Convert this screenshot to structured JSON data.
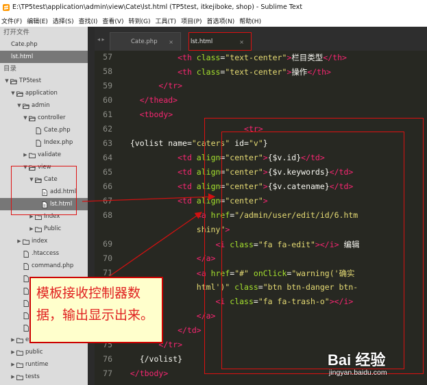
{
  "window": {
    "title": "E:\\TP5test\\application\\admin\\view\\Cate\\lst.html (TP5test, itkejiboke, shop) - Sublime Text"
  },
  "menu": [
    "文件(F)",
    "编辑(E)",
    "选择(S)",
    "查找(I)",
    "查看(V)",
    "转到(G)",
    "工具(T)",
    "项目(P)",
    "首选项(N)",
    "帮助(H)"
  ],
  "sidebar": {
    "open_files_header": "打开文件",
    "open_files": [
      "Cate.php",
      "lst.html"
    ],
    "folders_header": "目录",
    "tree": [
      {
        "label": "TP5test",
        "depth": 0,
        "type": "folder",
        "open": true
      },
      {
        "label": "application",
        "depth": 1,
        "type": "folder",
        "open": true
      },
      {
        "label": "admin",
        "depth": 2,
        "type": "folder",
        "open": true
      },
      {
        "label": "controller",
        "depth": 3,
        "type": "folder",
        "open": true
      },
      {
        "label": "Cate.php",
        "depth": 4,
        "type": "file"
      },
      {
        "label": "Index.php",
        "depth": 4,
        "type": "file"
      },
      {
        "label": "validate",
        "depth": 3,
        "type": "folder",
        "open": false
      },
      {
        "label": "view",
        "depth": 3,
        "type": "folder",
        "open": true
      },
      {
        "label": "Cate",
        "depth": 4,
        "type": "folder",
        "open": true
      },
      {
        "label": "add.html",
        "depth": 5,
        "type": "code"
      },
      {
        "label": "lst.html",
        "depth": 5,
        "type": "code",
        "selected": true
      },
      {
        "label": "Index",
        "depth": 4,
        "type": "folder",
        "open": false
      },
      {
        "label": "Public",
        "depth": 4,
        "type": "folder",
        "open": false
      },
      {
        "label": "index",
        "depth": 2,
        "type": "folder",
        "open": false
      },
      {
        "label": ".htaccess",
        "depth": 2,
        "type": "file"
      },
      {
        "label": "command.php",
        "depth": 2,
        "type": "file"
      },
      {
        "label": "",
        "depth": 2,
        "type": "file"
      },
      {
        "label": "",
        "depth": 2,
        "type": "file"
      },
      {
        "label": "",
        "depth": 2,
        "type": "file"
      },
      {
        "label": "",
        "depth": 2,
        "type": "file"
      },
      {
        "label": "",
        "depth": 2,
        "type": "file"
      },
      {
        "label": "ex",
        "depth": 1,
        "type": "folder",
        "open": false
      },
      {
        "label": "public",
        "depth": 1,
        "type": "folder",
        "open": false
      },
      {
        "label": "runtime",
        "depth": 1,
        "type": "folder",
        "open": false
      },
      {
        "label": "tests",
        "depth": 1,
        "type": "folder",
        "open": false
      }
    ]
  },
  "tabs": [
    {
      "label": "Cate.php",
      "close": "×"
    },
    {
      "label": "lst.html",
      "close": "×"
    }
  ],
  "tab_nav": "◂ ▸",
  "editor": {
    "lines": [
      {
        "n": "57",
        "indent": "            ",
        "segs": [
          [
            "t",
            "<th "
          ],
          [
            "a",
            "class"
          ],
          [
            "w",
            "="
          ],
          [
            "s",
            "\"text-center\""
          ],
          [
            "t",
            ">"
          ],
          [
            "w",
            "栏目类型"
          ],
          [
            "t",
            "</th>"
          ]
        ]
      },
      {
        "n": "58",
        "indent": "            ",
        "segs": [
          [
            "t",
            "<th "
          ],
          [
            "a",
            "class"
          ],
          [
            "w",
            "="
          ],
          [
            "s",
            "\"text-center\""
          ],
          [
            "t",
            ">"
          ],
          [
            "w",
            "操作"
          ],
          [
            "t",
            "</th>"
          ]
        ]
      },
      {
        "n": "59",
        "indent": "        ",
        "segs": [
          [
            "t",
            "</tr>"
          ]
        ]
      },
      {
        "n": "60",
        "indent": "    ",
        "segs": [
          [
            "t",
            "</thead>"
          ]
        ]
      },
      {
        "n": "61",
        "indent": "    ",
        "segs": [
          [
            "t",
            "<tbody>"
          ]
        ]
      },
      {
        "n": "62",
        "indent": "                          ",
        "segs": [
          [
            "t",
            "<tr>"
          ]
        ]
      },
      {
        "n": "63",
        "indent": "  ",
        "segs": [
          [
            "w",
            "{volist name="
          ],
          [
            "s",
            "\"caters\""
          ],
          [
            "w",
            " id="
          ],
          [
            "s",
            "\"v\""
          ],
          [
            "w",
            "}"
          ]
        ]
      },
      {
        "n": "64",
        "indent": "            ",
        "segs": [
          [
            "t",
            "<td "
          ],
          [
            "a",
            "align"
          ],
          [
            "w",
            "="
          ],
          [
            "s",
            "\"center\""
          ],
          [
            "t",
            ">"
          ],
          [
            "w",
            "{$v.id}"
          ],
          [
            "t",
            "</td>"
          ]
        ]
      },
      {
        "n": "65",
        "indent": "            ",
        "segs": [
          [
            "t",
            "<td "
          ],
          [
            "a",
            "align"
          ],
          [
            "w",
            "="
          ],
          [
            "s",
            "\"center\""
          ],
          [
            "t",
            ">"
          ],
          [
            "w",
            "{$v.keywords}"
          ],
          [
            "t",
            "</td>"
          ]
        ]
      },
      {
        "n": "66",
        "indent": "            ",
        "segs": [
          [
            "t",
            "<td "
          ],
          [
            "a",
            "align"
          ],
          [
            "w",
            "="
          ],
          [
            "s",
            "\"center\""
          ],
          [
            "t",
            ">"
          ],
          [
            "w",
            "{$v.catename}"
          ],
          [
            "t",
            "</td>"
          ]
        ]
      },
      {
        "n": "67",
        "indent": "            ",
        "segs": [
          [
            "t",
            "<td "
          ],
          [
            "a",
            "align"
          ],
          [
            "w",
            "="
          ],
          [
            "s",
            "\"center\""
          ],
          [
            "t",
            ">"
          ]
        ]
      },
      {
        "n": "68",
        "indent": "                ",
        "segs": [
          [
            "t",
            "<a "
          ],
          [
            "a",
            "href"
          ],
          [
            "w",
            "="
          ],
          [
            "s",
            "\"/admin/user/edit/id/6.htm"
          ]
        ]
      },
      {
        "n": "",
        "indent": "                ",
        "segs": [
          [
            "s",
            "shiny\""
          ],
          [
            "t",
            ">"
          ]
        ]
      },
      {
        "n": "69",
        "indent": "                    ",
        "segs": [
          [
            "t",
            "<i "
          ],
          [
            "a",
            "class"
          ],
          [
            "w",
            "="
          ],
          [
            "s",
            "\"fa fa-edit\""
          ],
          [
            "t",
            "></i>"
          ],
          [
            "w",
            " 编辑"
          ]
        ]
      },
      {
        "n": "70",
        "indent": "                ",
        "segs": [
          [
            "t",
            "</a>"
          ]
        ]
      },
      {
        "n": "71",
        "indent": "                ",
        "segs": [
          [
            "t",
            "<a "
          ],
          [
            "a",
            "href"
          ],
          [
            "w",
            "="
          ],
          [
            "s",
            "\"#\""
          ],
          [
            "a",
            " onClick"
          ],
          [
            "w",
            "="
          ],
          [
            "s",
            "\"warning('确实"
          ]
        ]
      },
      {
        "n": "",
        "indent": "                ",
        "segs": [
          [
            "s",
            "html')\""
          ],
          [
            "a",
            " class"
          ],
          [
            "w",
            "="
          ],
          [
            "s",
            "\"btn btn-danger btn-"
          ]
        ]
      },
      {
        "n": "72",
        "indent": "                    ",
        "segs": [
          [
            "t",
            "<i "
          ],
          [
            "a",
            "class"
          ],
          [
            "w",
            "="
          ],
          [
            "s",
            "\"fa fa-trash-o\""
          ],
          [
            "t",
            "></i>"
          ]
        ]
      },
      {
        "n": "73",
        "indent": "                ",
        "segs": [
          [
            "t",
            "</a>"
          ]
        ]
      },
      {
        "n": "74",
        "indent": "            ",
        "segs": [
          [
            "t",
            "</td>"
          ]
        ]
      },
      {
        "n": "75",
        "indent": "        ",
        "segs": [
          [
            "t",
            "</tr>"
          ]
        ]
      },
      {
        "n": "76",
        "indent": "    ",
        "segs": [
          [
            "w",
            "{/volist}"
          ]
        ]
      },
      {
        "n": "77",
        "indent": "  ",
        "segs": [
          [
            "t",
            "</tbody>"
          ]
        ]
      }
    ]
  },
  "callout": {
    "text": "模板接收控制器数据，输出显示出来。"
  },
  "watermark": {
    "brand": "Bai 经验",
    "url": "jingyan.baidu.com"
  },
  "colors": {
    "accent_red": "#d11111",
    "editor_bg": "#272822",
    "tag": "#f92672",
    "attr": "#a6e22e",
    "string": "#e6db74"
  }
}
